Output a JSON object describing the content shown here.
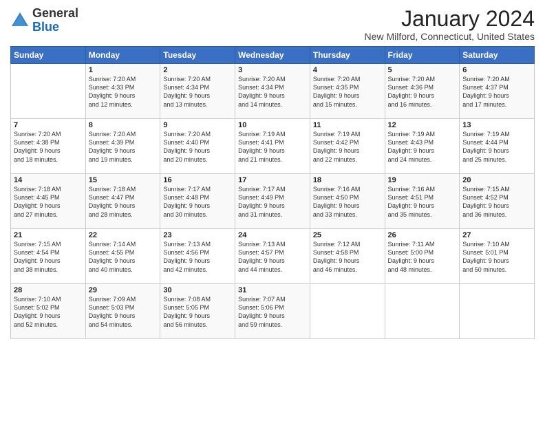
{
  "header": {
    "logo_general": "General",
    "logo_blue": "Blue",
    "month_title": "January 2024",
    "subtitle": "New Milford, Connecticut, United States"
  },
  "days_of_week": [
    "Sunday",
    "Monday",
    "Tuesday",
    "Wednesday",
    "Thursday",
    "Friday",
    "Saturday"
  ],
  "weeks": [
    [
      {
        "day": "",
        "content": ""
      },
      {
        "day": "1",
        "content": "Sunrise: 7:20 AM\nSunset: 4:33 PM\nDaylight: 9 hours\nand 12 minutes."
      },
      {
        "day": "2",
        "content": "Sunrise: 7:20 AM\nSunset: 4:34 PM\nDaylight: 9 hours\nand 13 minutes."
      },
      {
        "day": "3",
        "content": "Sunrise: 7:20 AM\nSunset: 4:34 PM\nDaylight: 9 hours\nand 14 minutes."
      },
      {
        "day": "4",
        "content": "Sunrise: 7:20 AM\nSunset: 4:35 PM\nDaylight: 9 hours\nand 15 minutes."
      },
      {
        "day": "5",
        "content": "Sunrise: 7:20 AM\nSunset: 4:36 PM\nDaylight: 9 hours\nand 16 minutes."
      },
      {
        "day": "6",
        "content": "Sunrise: 7:20 AM\nSunset: 4:37 PM\nDaylight: 9 hours\nand 17 minutes."
      }
    ],
    [
      {
        "day": "7",
        "content": "Sunrise: 7:20 AM\nSunset: 4:38 PM\nDaylight: 9 hours\nand 18 minutes."
      },
      {
        "day": "8",
        "content": "Sunrise: 7:20 AM\nSunset: 4:39 PM\nDaylight: 9 hours\nand 19 minutes."
      },
      {
        "day": "9",
        "content": "Sunrise: 7:20 AM\nSunset: 4:40 PM\nDaylight: 9 hours\nand 20 minutes."
      },
      {
        "day": "10",
        "content": "Sunrise: 7:19 AM\nSunset: 4:41 PM\nDaylight: 9 hours\nand 21 minutes."
      },
      {
        "day": "11",
        "content": "Sunrise: 7:19 AM\nSunset: 4:42 PM\nDaylight: 9 hours\nand 22 minutes."
      },
      {
        "day": "12",
        "content": "Sunrise: 7:19 AM\nSunset: 4:43 PM\nDaylight: 9 hours\nand 24 minutes."
      },
      {
        "day": "13",
        "content": "Sunrise: 7:19 AM\nSunset: 4:44 PM\nDaylight: 9 hours\nand 25 minutes."
      }
    ],
    [
      {
        "day": "14",
        "content": "Sunrise: 7:18 AM\nSunset: 4:45 PM\nDaylight: 9 hours\nand 27 minutes."
      },
      {
        "day": "15",
        "content": "Sunrise: 7:18 AM\nSunset: 4:47 PM\nDaylight: 9 hours\nand 28 minutes."
      },
      {
        "day": "16",
        "content": "Sunrise: 7:17 AM\nSunset: 4:48 PM\nDaylight: 9 hours\nand 30 minutes."
      },
      {
        "day": "17",
        "content": "Sunrise: 7:17 AM\nSunset: 4:49 PM\nDaylight: 9 hours\nand 31 minutes."
      },
      {
        "day": "18",
        "content": "Sunrise: 7:16 AM\nSunset: 4:50 PM\nDaylight: 9 hours\nand 33 minutes."
      },
      {
        "day": "19",
        "content": "Sunrise: 7:16 AM\nSunset: 4:51 PM\nDaylight: 9 hours\nand 35 minutes."
      },
      {
        "day": "20",
        "content": "Sunrise: 7:15 AM\nSunset: 4:52 PM\nDaylight: 9 hours\nand 36 minutes."
      }
    ],
    [
      {
        "day": "21",
        "content": "Sunrise: 7:15 AM\nSunset: 4:54 PM\nDaylight: 9 hours\nand 38 minutes."
      },
      {
        "day": "22",
        "content": "Sunrise: 7:14 AM\nSunset: 4:55 PM\nDaylight: 9 hours\nand 40 minutes."
      },
      {
        "day": "23",
        "content": "Sunrise: 7:13 AM\nSunset: 4:56 PM\nDaylight: 9 hours\nand 42 minutes."
      },
      {
        "day": "24",
        "content": "Sunrise: 7:13 AM\nSunset: 4:57 PM\nDaylight: 9 hours\nand 44 minutes."
      },
      {
        "day": "25",
        "content": "Sunrise: 7:12 AM\nSunset: 4:58 PM\nDaylight: 9 hours\nand 46 minutes."
      },
      {
        "day": "26",
        "content": "Sunrise: 7:11 AM\nSunset: 5:00 PM\nDaylight: 9 hours\nand 48 minutes."
      },
      {
        "day": "27",
        "content": "Sunrise: 7:10 AM\nSunset: 5:01 PM\nDaylight: 9 hours\nand 50 minutes."
      }
    ],
    [
      {
        "day": "28",
        "content": "Sunrise: 7:10 AM\nSunset: 5:02 PM\nDaylight: 9 hours\nand 52 minutes."
      },
      {
        "day": "29",
        "content": "Sunrise: 7:09 AM\nSunset: 5:03 PM\nDaylight: 9 hours\nand 54 minutes."
      },
      {
        "day": "30",
        "content": "Sunrise: 7:08 AM\nSunset: 5:05 PM\nDaylight: 9 hours\nand 56 minutes."
      },
      {
        "day": "31",
        "content": "Sunrise: 7:07 AM\nSunset: 5:06 PM\nDaylight: 9 hours\nand 59 minutes."
      },
      {
        "day": "",
        "content": ""
      },
      {
        "day": "",
        "content": ""
      },
      {
        "day": "",
        "content": ""
      }
    ]
  ]
}
